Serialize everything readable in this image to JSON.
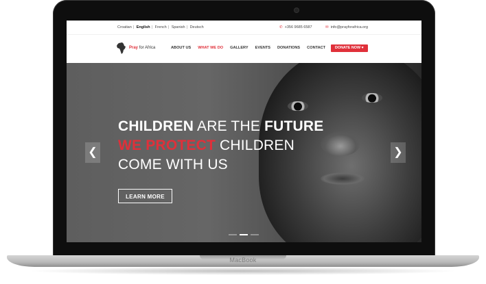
{
  "device": {
    "brand": "MacBook"
  },
  "topbar": {
    "languages": [
      "Croatian",
      "English",
      "French",
      "Spanish",
      "Deutsch"
    ],
    "separator": "|",
    "phone": "+356 9685 6587",
    "email": "info@prayforafrica.org"
  },
  "nav": {
    "logo_pray": "Pray",
    "logo_rest": "for Africa",
    "items": [
      "ABOUT US",
      "WHAT WE DO",
      "GALLERY",
      "EVENTS",
      "DONATIONS",
      "CONTACT"
    ],
    "donate_label": "DONATE NOW"
  },
  "hero": {
    "line1_a": "CHILDREN",
    "line1_b": "ARE THE",
    "line1_c": "FUTURE",
    "line2_a": "WE PROTECT",
    "line2_b": "CHILDREN",
    "line3": "COME WITH US",
    "button_label": "LEARN MORE",
    "prev_arrow": "❮",
    "next_arrow": "❯"
  },
  "colors": {
    "accent": "#e0303a",
    "hero_text": "#ffffff",
    "frame": "#0e0e0e"
  }
}
